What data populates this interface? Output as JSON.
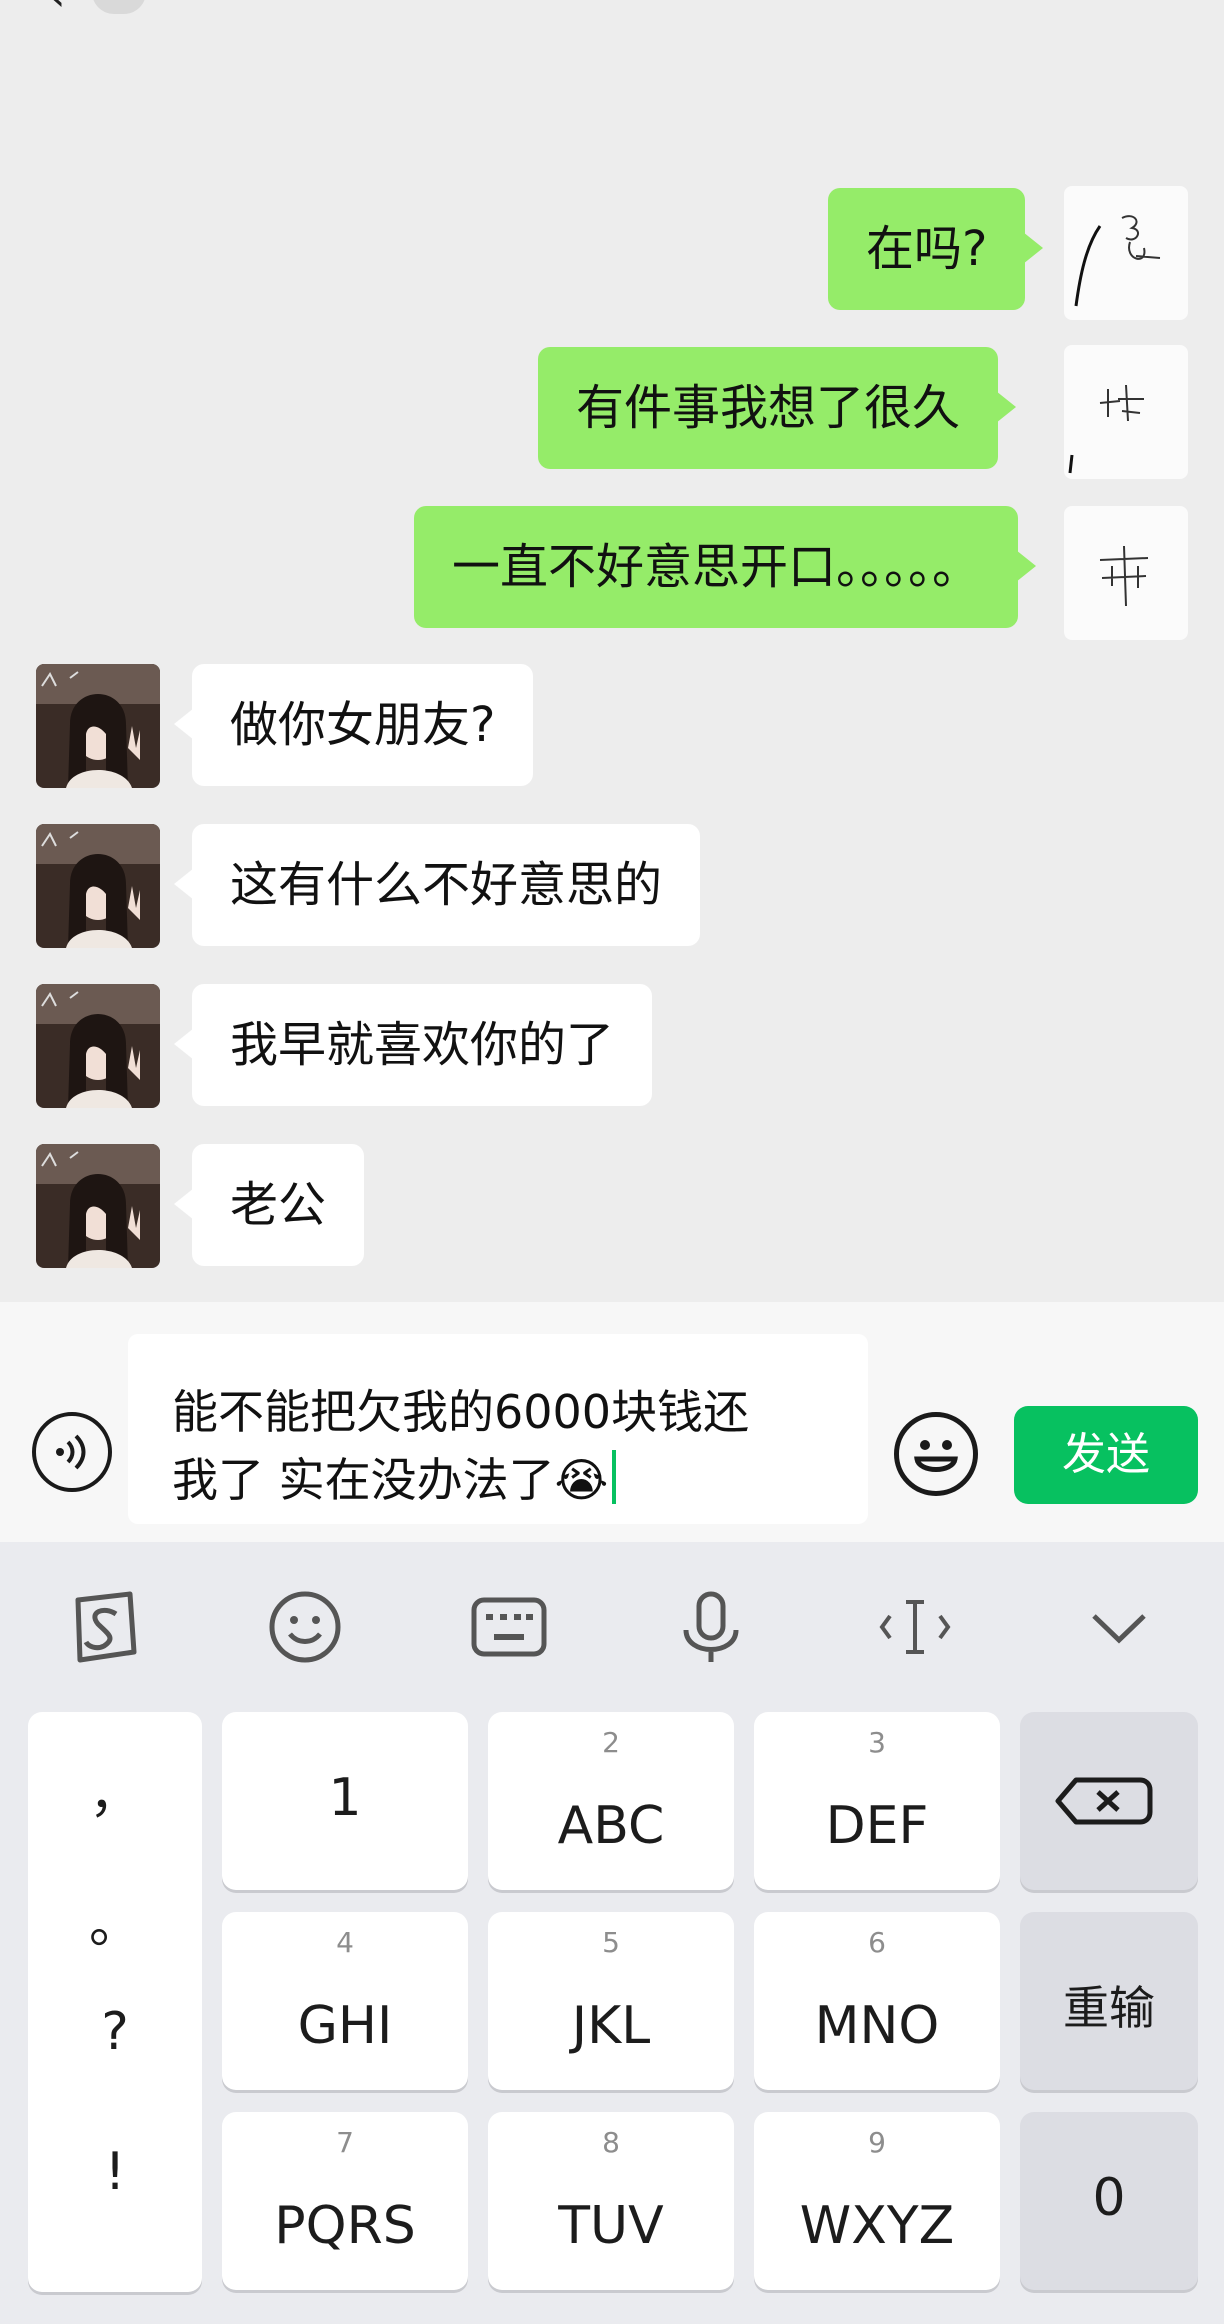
{
  "messages": [
    {
      "side": "out",
      "text": "在吗?"
    },
    {
      "side": "out",
      "text": "有件事我想了很久"
    },
    {
      "side": "out",
      "text": "一直不好意思开口。。。。。"
    },
    {
      "side": "in",
      "text": "做你女朋友?"
    },
    {
      "side": "in",
      "text": "这有什么不好意思的"
    },
    {
      "side": "in",
      "text": "我早就喜欢你的了"
    },
    {
      "side": "in",
      "text": "老公"
    }
  ],
  "input": {
    "line1": "能不能把欠我的6000块钱还",
    "line2": "我了 实在没办法了😭",
    "send_label": "发送"
  },
  "keyboard": {
    "toolbar": [
      "sogou-icon",
      "emoji-icon",
      "keyboard-icon",
      "microphone-icon",
      "cursor-icon",
      "collapse-icon"
    ],
    "punctuation": [
      "，",
      "。",
      "?",
      "!"
    ],
    "keys": [
      {
        "num": "",
        "label": "1"
      },
      {
        "num": "2",
        "label": "ABC"
      },
      {
        "num": "3",
        "label": "DEF"
      },
      {
        "num": "4",
        "label": "GHI"
      },
      {
        "num": "5",
        "label": "JKL"
      },
      {
        "num": "6",
        "label": "MNO"
      },
      {
        "num": "7",
        "label": "PQRS"
      },
      {
        "num": "8",
        "label": "TUV"
      },
      {
        "num": "9",
        "label": "WXYZ"
      }
    ],
    "reinput_label": "重输",
    "zero_label": "0"
  },
  "colors": {
    "out_bubble": "#95ec69",
    "in_bubble": "#ffffff",
    "send": "#07c160",
    "background": "#ededed"
  }
}
